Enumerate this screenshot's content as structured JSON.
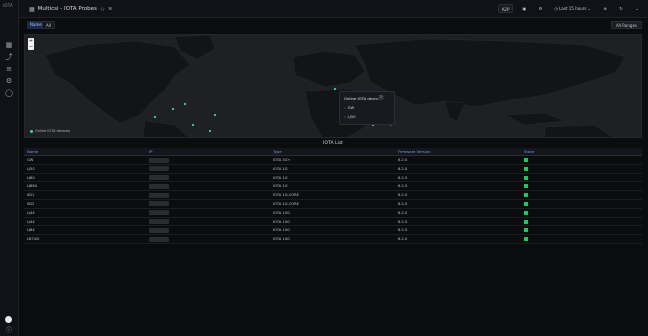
{
  "rail": {
    "logo": "IOTA",
    "icons": [
      "dashboards-icon",
      "explore-icon",
      "alerting-icon",
      "settings-icon",
      "shield-icon"
    ]
  },
  "header": {
    "title": "Multicsi - IOTA Probes",
    "user_badge": "A2P",
    "time_range": "Last 15 hours",
    "refresh_label": "",
    "colors": {
      "accent": "#6e9fff",
      "status_ok": "#22c55e",
      "map_dot": "#3fd58a"
    }
  },
  "variables": {
    "label": "Name",
    "value": "All",
    "button": "All Ranges"
  },
  "map": {
    "legend_label": "Online IOTA devices",
    "popup": {
      "title": "Online IOTA devices",
      "badge": "2",
      "items": [
        "GW",
        "LJ50"
      ]
    }
  },
  "table": {
    "title": "IOTA List",
    "columns": [
      "Name",
      "IP",
      "Type",
      "Firmware Version",
      "State"
    ],
    "rows": [
      {
        "name": "GW",
        "type": "IOTA 3G+",
        "fw": "6.2.0"
      },
      {
        "name": "LJ50",
        "type": "IOTA 1G",
        "fw": "6.2.0"
      },
      {
        "name": "LJ60",
        "type": "IOTA 1G",
        "fw": "6.2.0"
      },
      {
        "name": "LJ884",
        "type": "IOTA 1G",
        "fw": "6.2.0"
      },
      {
        "name": "SD1",
        "type": "IOTA 1G-CORE",
        "fw": "6.2.0"
      },
      {
        "name": "SD2",
        "type": "IOTA 1G-CORE",
        "fw": "6.2.0"
      },
      {
        "name": "LJ44",
        "type": "IOTA 10G",
        "fw": "6.2.0"
      },
      {
        "name": "LJ44",
        "type": "IOTA 10G",
        "fw": "6.2.0"
      },
      {
        "name": "LJ84",
        "type": "IOTA 10G",
        "fw": "6.2.0"
      },
      {
        "name": "LB742I",
        "type": "IOTA 10G",
        "fw": "6.2.0"
      }
    ]
  }
}
